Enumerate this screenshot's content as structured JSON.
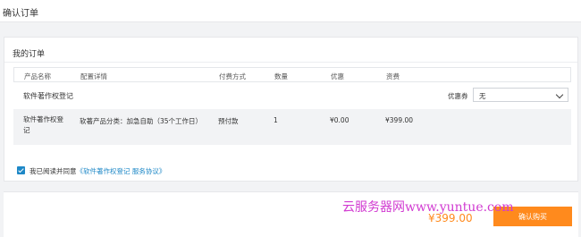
{
  "header": {
    "title": "确认订单"
  },
  "order": {
    "title": "我的订单",
    "columns": [
      "产品名称",
      "配置详情",
      "付费方式",
      "数量",
      "优惠",
      "资费"
    ],
    "group_name": "软件著作权登记",
    "coupon": {
      "label": "优惠券",
      "value": "无"
    },
    "row": {
      "product_line1": "软件著作权登",
      "product_line2": "记",
      "config": "软著产品分类：加急自助（35个工作日）",
      "payment": "预付款",
      "quantity": "1",
      "discount": "¥0.00",
      "price": "¥399.00"
    }
  },
  "agreement": {
    "checked": true,
    "text": "我已阅读并同意",
    "link": "《软件著作权登记 服务协议》"
  },
  "footer": {
    "total": "¥399.00",
    "buy_button": "确认购买"
  },
  "watermark": "云服务器网www.yuntue.com",
  "colors": {
    "accent": "#ff8a1d",
    "link": "#1e88c7"
  }
}
